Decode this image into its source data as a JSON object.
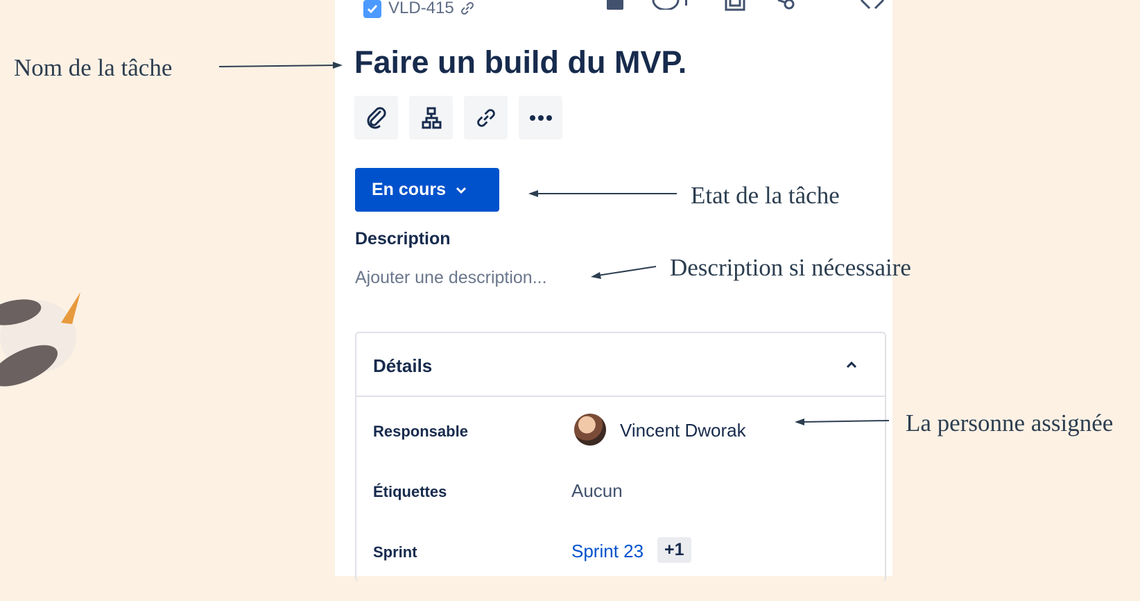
{
  "issue": {
    "key": "VLD-415",
    "title": "Faire un build du MVP.",
    "status": "En cours",
    "description_label": "Description",
    "description_placeholder": "Ajouter une description...",
    "details_label": "Détails",
    "fields": {
      "assignee_label": "Responsable",
      "assignee_value": "Vincent Dworak",
      "labels_label": "Étiquettes",
      "labels_value": "Aucun",
      "sprint_label": "Sprint",
      "sprint_value": "Sprint 23",
      "sprint_extra": "+1"
    }
  },
  "toolbar": {
    "icons": [
      "attach-icon",
      "child-issues-icon",
      "link-icon",
      "more-icon"
    ]
  },
  "header_icons": [
    "bookmark-icon",
    "watch-icon",
    "copy-icon",
    "share-icon",
    "close-icon"
  ],
  "annotations": {
    "task_name": "Nom de la tâche",
    "task_status": "Etat de la tâche",
    "description_note": "Description si nécessaire",
    "assignee_note": "La personne assignée"
  },
  "colors": {
    "background": "#fdf1e4",
    "primary": "#0052cc",
    "text": "#172b4d"
  }
}
